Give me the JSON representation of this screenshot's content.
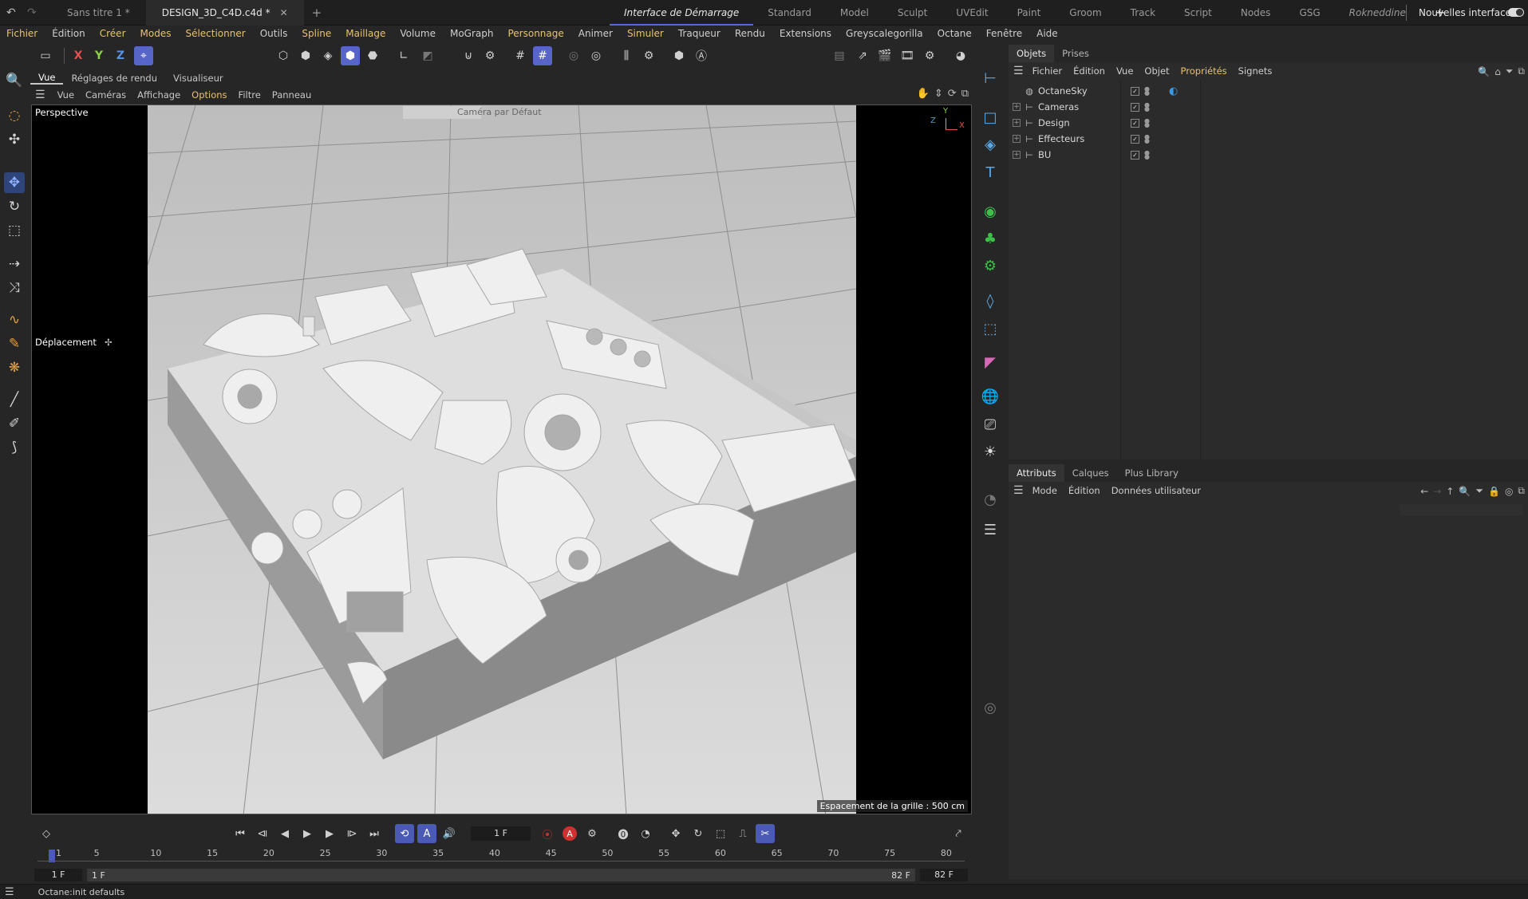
{
  "tabs": {
    "items": [
      {
        "label": "Sans titre 1 *"
      },
      {
        "label": "DESIGN_3D_C4D.c4d *"
      }
    ],
    "new_tab": "+",
    "close_glyph": "✕"
  },
  "layouts": {
    "items": [
      {
        "label": "Interface de Démarrage"
      },
      {
        "label": "Standard"
      },
      {
        "label": "Model"
      },
      {
        "label": "Sculpt"
      },
      {
        "label": "UVEdit"
      },
      {
        "label": "Paint"
      },
      {
        "label": "Groom"
      },
      {
        "label": "Track"
      },
      {
        "label": "Script"
      },
      {
        "label": "Nodes"
      },
      {
        "label": "GSG"
      },
      {
        "label": "Rokneddine"
      }
    ],
    "add": "+",
    "new_layouts": "Nouvelles interfaces"
  },
  "menubar": {
    "items": [
      {
        "label": "Fichier"
      },
      {
        "label": "Édition"
      },
      {
        "label": "Créer"
      },
      {
        "label": "Modes"
      },
      {
        "label": "Sélectionner"
      },
      {
        "label": "Outils"
      },
      {
        "label": "Spline"
      },
      {
        "label": "Maillage"
      },
      {
        "label": "Volume"
      },
      {
        "label": "MoGraph"
      },
      {
        "label": "Personnage"
      },
      {
        "label": "Animer"
      },
      {
        "label": "Simuler"
      },
      {
        "label": "Traqueur"
      },
      {
        "label": "Rendu"
      },
      {
        "label": "Extensions"
      },
      {
        "label": "Greyscalegorilla"
      },
      {
        "label": "Octane"
      },
      {
        "label": "Fenêtre"
      },
      {
        "label": "Aide"
      }
    ]
  },
  "axis": {
    "x": "X",
    "y": "Y",
    "z": "Z"
  },
  "viewport": {
    "tabs": [
      {
        "label": "Vue"
      },
      {
        "label": "Réglages de rendu"
      },
      {
        "label": "Visualiseur"
      }
    ],
    "menu": [
      {
        "label": "Vue"
      },
      {
        "label": "Caméras"
      },
      {
        "label": "Affichage"
      },
      {
        "label": "Options"
      },
      {
        "label": "Filtre"
      },
      {
        "label": "Panneau"
      }
    ],
    "perspective": "Perspective",
    "camera": "Caméra par Défaut",
    "hud_tool": "Déplacement",
    "grid_spacing": "Espacement de la grille : 500 cm",
    "gizmo": {
      "x": "X",
      "y": "Y",
      "z": "Z"
    }
  },
  "objects_panel": {
    "tabs": [
      {
        "label": "Objets"
      },
      {
        "label": "Prises"
      }
    ],
    "menu": [
      {
        "label": "Fichier"
      },
      {
        "label": "Édition"
      },
      {
        "label": "Vue"
      },
      {
        "label": "Objet"
      },
      {
        "label": "Propriétés"
      },
      {
        "label": "Signets"
      }
    ],
    "objects": [
      {
        "name": "OctaneSky"
      },
      {
        "name": "Cameras"
      },
      {
        "name": "Design"
      },
      {
        "name": "Effecteurs"
      },
      {
        "name": "BU"
      }
    ]
  },
  "attributes_panel": {
    "tabs": [
      {
        "label": "Attributs"
      },
      {
        "label": "Calques"
      },
      {
        "label": "Plus Library"
      }
    ],
    "menu": [
      {
        "label": "Mode"
      },
      {
        "label": "Édition"
      },
      {
        "label": "Données utilisateur"
      }
    ]
  },
  "timeline": {
    "current_frame": "1 F",
    "ticks": [
      "5",
      "10",
      "15",
      "20",
      "25",
      "30",
      "35",
      "40",
      "45",
      "50",
      "55",
      "60",
      "65",
      "70",
      "75",
      "80"
    ],
    "first_tick": "1",
    "start_field": "1 F",
    "range_start": "1 F",
    "range_end": "82 F",
    "end_field": "82 F"
  },
  "status": {
    "text": "Octane:init defaults"
  },
  "colors": {
    "accent": "#5865c8",
    "highlight_text": "#e8c36a",
    "green_icons": "#3fbf4a",
    "blue_icons": "#5aa8e6",
    "pink_icons": "#d66ab8"
  }
}
